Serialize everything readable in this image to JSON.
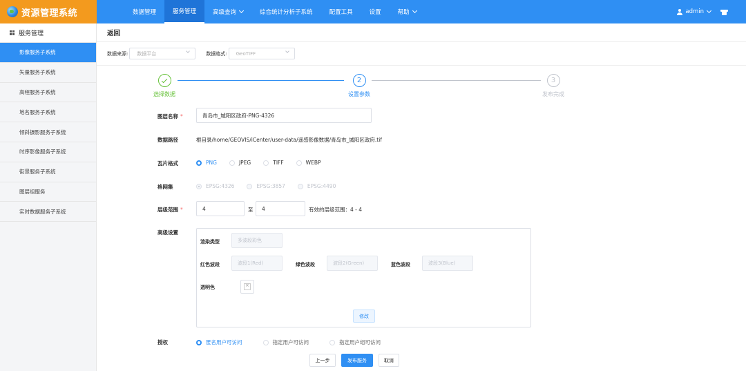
{
  "app": {
    "title": "资源管理系统"
  },
  "nav": {
    "items": [
      {
        "label": "数据管理",
        "active": false,
        "dropdown": false
      },
      {
        "label": "服务管理",
        "active": true,
        "dropdown": false
      },
      {
        "label": "高级查询",
        "active": false,
        "dropdown": true
      },
      {
        "label": "综合统计分析子系统",
        "active": false,
        "dropdown": false
      },
      {
        "label": "配置工具",
        "active": false,
        "dropdown": false
      },
      {
        "label": "设置",
        "active": false,
        "dropdown": false
      },
      {
        "label": "帮助",
        "active": false,
        "dropdown": true
      }
    ],
    "user": "admin"
  },
  "sidebar": {
    "header": "服务管理",
    "items": [
      {
        "label": "影像服务子系统",
        "active": true
      },
      {
        "label": "矢量服务子系统",
        "active": false
      },
      {
        "label": "高程服务子系统",
        "active": false
      },
      {
        "label": "地名服务子系统",
        "active": false
      },
      {
        "label": "倾斜摄影服务子系统",
        "active": false
      },
      {
        "label": "时序影像服务子系统",
        "active": false
      },
      {
        "label": "街景服务子系统",
        "active": false
      },
      {
        "label": "图层组服务",
        "active": false
      },
      {
        "label": "实时数据服务子系统",
        "active": false
      }
    ]
  },
  "main": {
    "back": "返回",
    "filters": {
      "source_label": "数据来源:",
      "source_value": "数据平台",
      "format_label": "数据格式:",
      "format_value": "GeoTIFF"
    },
    "steps": [
      {
        "num": "1",
        "label": "选择数据",
        "status": "done"
      },
      {
        "num": "2",
        "label": "设置参数",
        "status": "active"
      },
      {
        "num": "3",
        "label": "发布完成",
        "status": "wait"
      }
    ],
    "form": {
      "layer_name_label": "图层名称",
      "layer_name_value": "青岛市_城阳区政府-PNG-4326",
      "data_path_label": "数据路径",
      "data_path_value": "根目录/home/GEOVIS/iCenter/user-data/遥感影像数据/青岛市_城阳区政府.tif",
      "tile_format_label": "瓦片格式",
      "tile_formats": [
        {
          "label": "PNG",
          "selected": true
        },
        {
          "label": "JPEG",
          "selected": false
        },
        {
          "label": "TIFF",
          "selected": false
        },
        {
          "label": "WEBP",
          "selected": false
        }
      ],
      "gridset_label": "格网集",
      "gridsets": [
        {
          "label": "EPSG:4326",
          "selected": true
        },
        {
          "label": "EPSG:3857",
          "selected": false
        },
        {
          "label": "EPSG:4490",
          "selected": false
        }
      ],
      "level_label": "层级范围",
      "level_from": "4",
      "level_to_sep": "至",
      "level_to": "4",
      "level_valid": "有效的层级范围：4 - 4",
      "advanced_label": "高级设置",
      "advanced": {
        "render_type_label": "渲染类型",
        "render_type_value": "多波段彩色",
        "red_label": "红色波段",
        "red_value": "波段1(Red)",
        "green_label": "绿色波段",
        "green_value": "波段2(Green)",
        "blue_label": "蓝色波段",
        "blue_value": "波段3(Blue)",
        "transparent_label": "透明色",
        "modify_button": "修改"
      },
      "auth_label": "授权",
      "auth_options": [
        {
          "label": "匿名用户可访问",
          "selected": true
        },
        {
          "label": "指定用户可访问",
          "selected": false
        },
        {
          "label": "指定用户组可访问",
          "selected": false
        }
      ]
    },
    "buttons": {
      "prev": "上一步",
      "publish": "发布服务",
      "cancel": "取消"
    }
  },
  "colors": {
    "primary": "#2f8ff3",
    "logo_bg": "#f39a1e",
    "success": "#67c23a",
    "required": "#f56c6c"
  }
}
